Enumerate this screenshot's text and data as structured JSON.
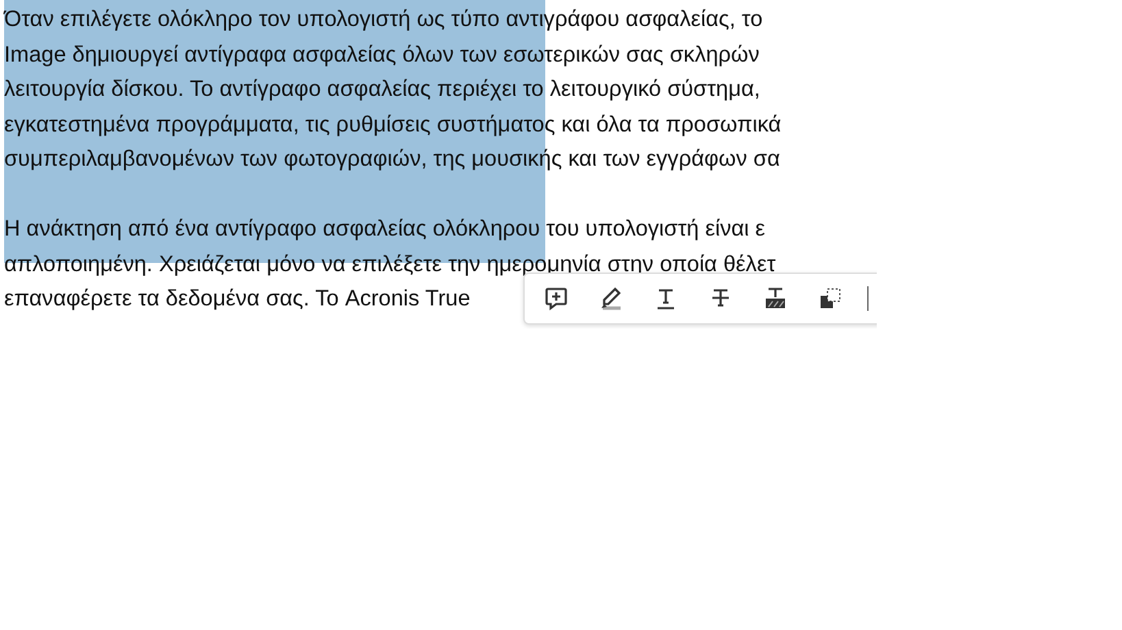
{
  "document": {
    "paragraphs": [
      {
        "lines": [
          "Όταν επιλέγετε ολόκληρο τον υπολογιστή ως τύπο αντιγράφου ασφαλείας, το",
          "Image δημιουργεί αντίγραφα ασφαλείας όλων των εσωτερικών σας σκληρών",
          "λειτουργία δίσκου. Το αντίγραφο ασφαλείας περιέχει το λειτουργικό σύστημα,",
          "εγκατεστημένα προγράμματα, τις ρυθμίσεις συστήματος και όλα τα προσωπικά",
          "συμπεριλαμβανομένων των φωτογραφιών, της μουσικής και των εγγράφων σα"
        ]
      },
      {
        "lines": [
          "Η ανάκτηση από ένα αντίγραφο ασφαλείας ολόκληρου του υπολογιστή είναι ε",
          "απλοποιημένη. Χρειάζεται μόνο να επιλέξετε την ημερομηνία στην οποία θέλετ",
          "επαναφέρετε τα δεδομένα σας. Το Acronis True"
        ]
      }
    ]
  }
}
